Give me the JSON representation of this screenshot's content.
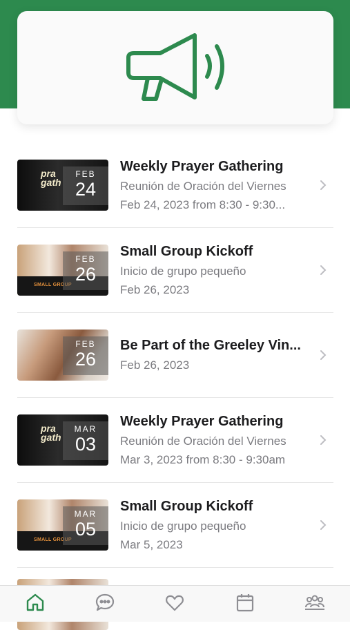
{
  "colors": {
    "accent": "#2d8a4e",
    "secondary_text": "#7b7b80"
  },
  "hero": {
    "icon": "megaphone-icon"
  },
  "events": [
    {
      "thumb": "prayer",
      "month": "FEB",
      "day": "24",
      "title": "Weekly Prayer Gathering",
      "subtitle": "Reunión de Oración del Viernes",
      "date": "Feb 24, 2023 from 8:30 - 9:30..."
    },
    {
      "thumb": "group",
      "month": "FEB",
      "day": "26",
      "title": "Small Group Kickoff",
      "subtitle": "Inicio de grupo pequeño",
      "date": "Feb 26, 2023"
    },
    {
      "thumb": "hands",
      "month": "FEB",
      "day": "26",
      "title": "Be Part of the Greeley Vin...",
      "subtitle": "",
      "date": "Feb 26, 2023"
    },
    {
      "thumb": "prayer",
      "month": "MAR",
      "day": "03",
      "title": "Weekly Prayer Gathering",
      "subtitle": "Reunión de Oración del Viernes",
      "date": "Mar 3, 2023 from 8:30 - 9:30am"
    },
    {
      "thumb": "group",
      "month": "MAR",
      "day": "05",
      "title": "Small Group Kickoff",
      "subtitle": "Inicio de grupo pequeño",
      "date": "Mar 5, 2023"
    }
  ],
  "tabs": [
    {
      "icon": "home-icon",
      "active": true
    },
    {
      "icon": "chat-bubble-icon",
      "active": false
    },
    {
      "icon": "heart-icon",
      "active": false
    },
    {
      "icon": "calendar-icon",
      "active": false
    },
    {
      "icon": "people-icon",
      "active": false
    }
  ]
}
